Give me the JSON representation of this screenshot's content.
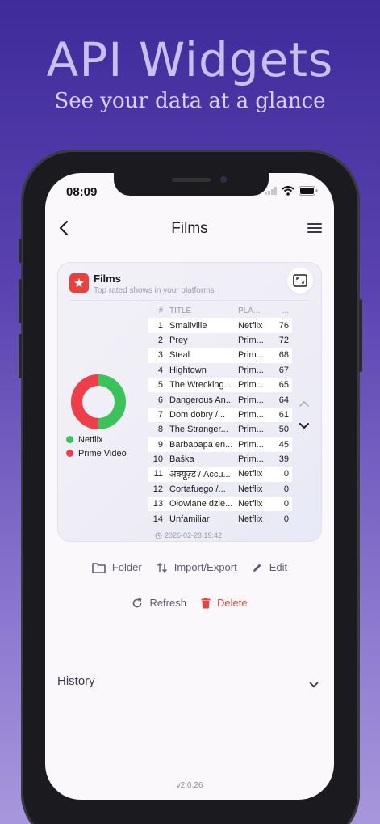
{
  "promo": {
    "headline": "API Widgets",
    "subline": "See your data at a glance"
  },
  "status_bar": {
    "time": "08:09"
  },
  "nav": {
    "title": "Films"
  },
  "widget": {
    "title": "Films",
    "subtitle": "Top rated shows in your platforms",
    "timestamp": "2026-02-28 19:42",
    "legend": [
      {
        "label": "Netflix",
        "color": "#3cc25a"
      },
      {
        "label": "Prime Video",
        "color": "#ef3e4a"
      }
    ],
    "columns": [
      "#",
      "TITLE",
      "PLA...",
      "..."
    ],
    "rows": [
      {
        "n": "1",
        "title": "Smallville",
        "platform": "Netflix",
        "value": "76"
      },
      {
        "n": "2",
        "title": "Prey",
        "platform": "Prim...",
        "value": "72"
      },
      {
        "n": "3",
        "title": "Steal",
        "platform": "Prim...",
        "value": "68"
      },
      {
        "n": "4",
        "title": "Hightown",
        "platform": "Prim...",
        "value": "67"
      },
      {
        "n": "5",
        "title": "The Wrecking...",
        "platform": "Prim...",
        "value": "65"
      },
      {
        "n": "6",
        "title": "Dangerous An...",
        "platform": "Prim...",
        "value": "64"
      },
      {
        "n": "7",
        "title": "Dom dobry /...",
        "platform": "Prim...",
        "value": "61"
      },
      {
        "n": "8",
        "title": "The Stranger...",
        "platform": "Prim...",
        "value": "50"
      },
      {
        "n": "9",
        "title": "Barbapapa en...",
        "platform": "Prim...",
        "value": "45"
      },
      {
        "n": "10",
        "title": "Baśka",
        "platform": "Prim...",
        "value": "39"
      },
      {
        "n": "11",
        "title": "अक्यूज़्ड / Accu...",
        "platform": "Netflix",
        "value": "0"
      },
      {
        "n": "12",
        "title": "Cortafuego /...",
        "platform": "Netflix",
        "value": "0"
      },
      {
        "n": "13",
        "title": "Ołowiane dzie...",
        "platform": "Netflix",
        "value": "0"
      },
      {
        "n": "14",
        "title": "Unfamiliar",
        "platform": "Netflix",
        "value": "0"
      }
    ],
    "donut": {
      "netflix_share": 0.5,
      "prime_share": 0.5
    }
  },
  "actions": {
    "folder": "Folder",
    "import_export": "Import/Export",
    "edit": "Edit",
    "refresh": "Refresh",
    "delete": "Delete"
  },
  "history": {
    "label": "History"
  },
  "version": "v2.0.26",
  "icons": {
    "back": "chevron-left-icon",
    "menu": "hamburger-menu-icon",
    "logo": "star-icon",
    "expand": "expand-icon",
    "folder": "folder-icon",
    "import_export": "swap-arrows-icon",
    "edit": "pencil-icon",
    "refresh": "refresh-icon",
    "delete": "trash-icon"
  },
  "colors": {
    "accent_red": "#e8413d",
    "delete_red": "#e0463c",
    "netflix_green": "#3cc25a",
    "prime_red": "#ef3e4a"
  }
}
